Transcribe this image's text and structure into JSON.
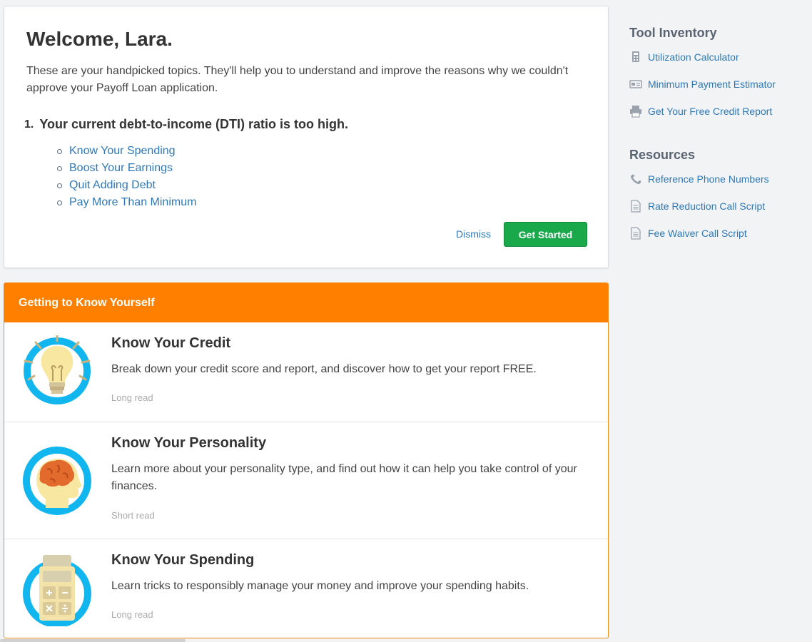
{
  "welcome": {
    "title": "Welcome, Lara.",
    "intro": "These are your handpicked topics. They'll help you to understand and improve the reasons why we couldn't approve your Payoff Loan application.",
    "reason_number": "1.",
    "reason_text": "Your current debt-to-income (DTI) ratio is too high.",
    "topics": [
      {
        "label": "Know Your Spending"
      },
      {
        "label": "Boost Your Earnings"
      },
      {
        "label": "Quit Adding Debt"
      },
      {
        "label": "Pay More Than Minimum"
      }
    ],
    "dismiss_label": "Dismiss",
    "get_started_label": "Get Started"
  },
  "section": {
    "header": "Getting to Know Yourself",
    "items": [
      {
        "title": "Know Your Credit",
        "description": "Break down your credit score and report, and discover how to get your report FREE.",
        "meta": "Long read",
        "icon": "lightbulb-icon"
      },
      {
        "title": "Know Your Personality",
        "description": "Learn more about your personality type, and find out how it can help you take control of your finances.",
        "meta": "Short read",
        "icon": "brain-head-icon"
      },
      {
        "title": "Know Your Spending",
        "description": "Learn tricks to responsibly manage your money and improve your spending habits.",
        "meta": "Long read",
        "icon": "calculator-icon"
      }
    ]
  },
  "sidebar": {
    "tool_title": "Tool Inventory",
    "tools": [
      {
        "label": "Utilization Calculator",
        "icon": "calculator-icon"
      },
      {
        "label": "Minimum Payment Estimator",
        "icon": "payment-card-icon"
      },
      {
        "label": "Get Your Free Credit Report",
        "icon": "printer-icon"
      }
    ],
    "resources_title": "Resources",
    "resources": [
      {
        "label": "Reference Phone Numbers",
        "icon": "phone-icon"
      },
      {
        "label": "Rate Reduction Call Script",
        "icon": "document-icon"
      },
      {
        "label": "Fee Waiver Call Script",
        "icon": "document-icon"
      }
    ]
  },
  "colors": {
    "accent_orange": "#ff7f00",
    "button_green": "#19a94a",
    "link_blue": "#2e78b8",
    "icon_ring_blue": "#11b6ef"
  }
}
